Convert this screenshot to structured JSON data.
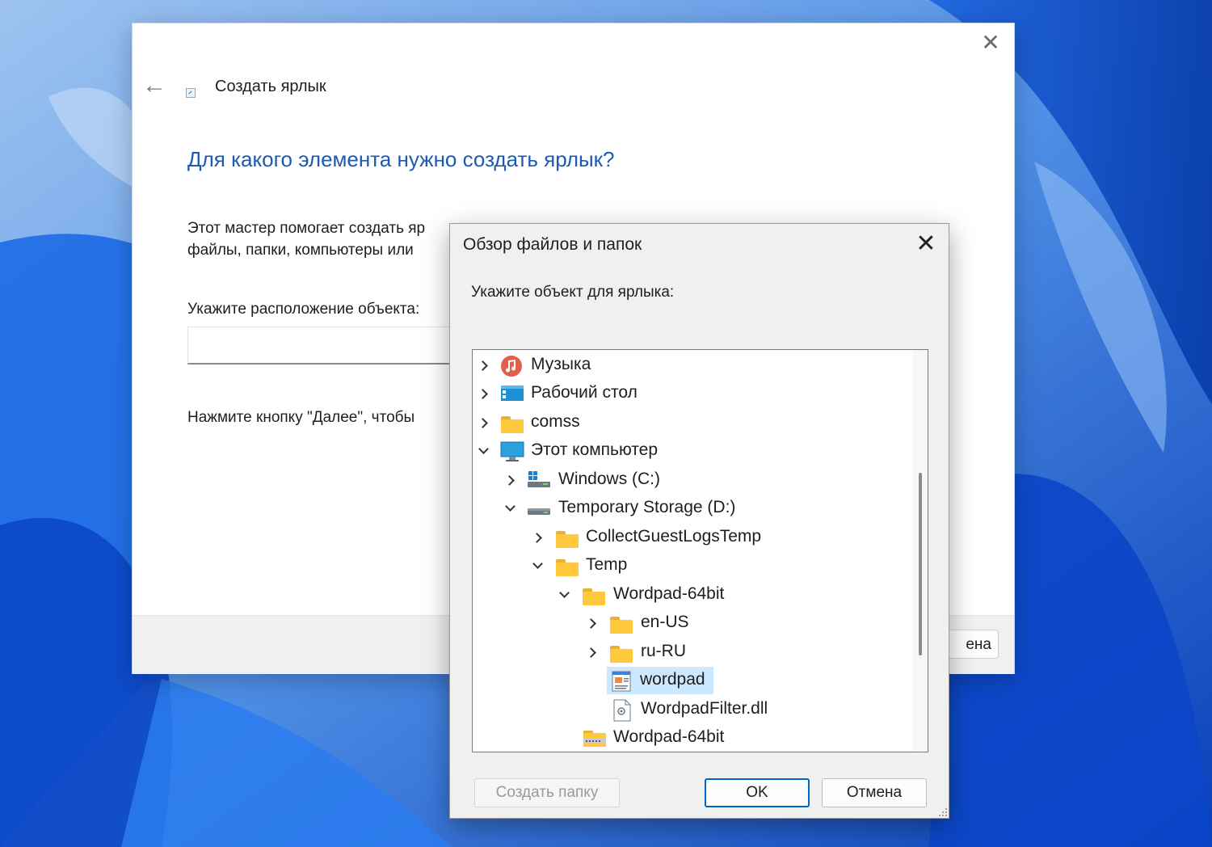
{
  "wizard": {
    "title": "Создать ярлык",
    "heading": "Для какого элемента нужно создать ярлык?",
    "desc_line1": "Этот мастер помогает создать яр",
    "desc_line2": "файлы, папки, компьютеры или",
    "location_label": "Укажите расположение объекта:",
    "location_value": "",
    "hint": "Нажмите кнопку \"Далее\", чтобы",
    "cancel_partial": "ена",
    "close_glyph": "✕",
    "back_glyph": "←"
  },
  "dialog": {
    "title": "Обзор файлов и папок",
    "close_glyph": "✕",
    "prompt": "Укажите объект для ярлыка:",
    "tree": [
      {
        "label": "Музыка",
        "expander": "right",
        "icon": "music-icon"
      },
      {
        "label": "Рабочий стол",
        "expander": "right",
        "icon": "desktop-icon"
      },
      {
        "label": "comss",
        "expander": "right",
        "icon": "folder-icon"
      },
      {
        "label": "Этот компьютер",
        "expander": "down",
        "icon": "computer-icon"
      },
      {
        "label": "Windows (C:)",
        "expander": "right",
        "icon": "windows-drive-icon"
      },
      {
        "label": "Temporary Storage (D:)",
        "expander": "down",
        "icon": "drive-icon"
      },
      {
        "label": "CollectGuestLogsTemp",
        "expander": "right",
        "icon": "folder-icon"
      },
      {
        "label": "Temp",
        "expander": "down",
        "icon": "folder-icon"
      },
      {
        "label": "Wordpad-64bit",
        "expander": "down",
        "icon": "folder-icon"
      },
      {
        "label": "en-US",
        "expander": "right",
        "icon": "folder-icon"
      },
      {
        "label": "ru-RU",
        "expander": "right",
        "icon": "folder-icon"
      },
      {
        "label": "wordpad",
        "expander": "none",
        "icon": "wordpad-exe-icon",
        "selected": true
      },
      {
        "label": "WordpadFilter.dll",
        "expander": "none",
        "icon": "dll-file-icon"
      },
      {
        "label": "Wordpad-64bit",
        "expander": "none",
        "icon": "zip-folder-icon"
      }
    ],
    "buttons": {
      "new_folder": "Создать папку",
      "ok": "OK",
      "cancel": "Отмена"
    }
  }
}
